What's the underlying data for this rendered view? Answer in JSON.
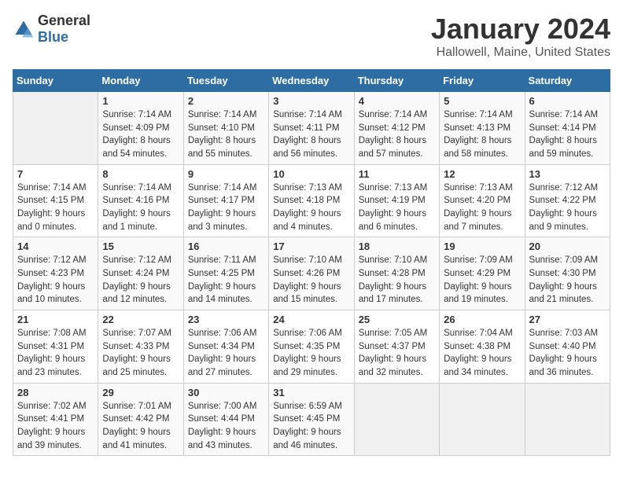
{
  "logo": {
    "general": "General",
    "blue": "Blue"
  },
  "header": {
    "month": "January 2024",
    "location": "Hallowell, Maine, United States"
  },
  "weekdays": [
    "Sunday",
    "Monday",
    "Tuesday",
    "Wednesday",
    "Thursday",
    "Friday",
    "Saturday"
  ],
  "weeks": [
    [
      {
        "day": "",
        "empty": true
      },
      {
        "day": "1",
        "sunrise": "Sunrise: 7:14 AM",
        "sunset": "Sunset: 4:09 PM",
        "daylight": "Daylight: 8 hours and 54 minutes."
      },
      {
        "day": "2",
        "sunrise": "Sunrise: 7:14 AM",
        "sunset": "Sunset: 4:10 PM",
        "daylight": "Daylight: 8 hours and 55 minutes."
      },
      {
        "day": "3",
        "sunrise": "Sunrise: 7:14 AM",
        "sunset": "Sunset: 4:11 PM",
        "daylight": "Daylight: 8 hours and 56 minutes."
      },
      {
        "day": "4",
        "sunrise": "Sunrise: 7:14 AM",
        "sunset": "Sunset: 4:12 PM",
        "daylight": "Daylight: 8 hours and 57 minutes."
      },
      {
        "day": "5",
        "sunrise": "Sunrise: 7:14 AM",
        "sunset": "Sunset: 4:13 PM",
        "daylight": "Daylight: 8 hours and 58 minutes."
      },
      {
        "day": "6",
        "sunrise": "Sunrise: 7:14 AM",
        "sunset": "Sunset: 4:14 PM",
        "daylight": "Daylight: 8 hours and 59 minutes."
      }
    ],
    [
      {
        "day": "7",
        "sunrise": "Sunrise: 7:14 AM",
        "sunset": "Sunset: 4:15 PM",
        "daylight": "Daylight: 9 hours and 0 minutes."
      },
      {
        "day": "8",
        "sunrise": "Sunrise: 7:14 AM",
        "sunset": "Sunset: 4:16 PM",
        "daylight": "Daylight: 9 hours and 1 minute."
      },
      {
        "day": "9",
        "sunrise": "Sunrise: 7:14 AM",
        "sunset": "Sunset: 4:17 PM",
        "daylight": "Daylight: 9 hours and 3 minutes."
      },
      {
        "day": "10",
        "sunrise": "Sunrise: 7:13 AM",
        "sunset": "Sunset: 4:18 PM",
        "daylight": "Daylight: 9 hours and 4 minutes."
      },
      {
        "day": "11",
        "sunrise": "Sunrise: 7:13 AM",
        "sunset": "Sunset: 4:19 PM",
        "daylight": "Daylight: 9 hours and 6 minutes."
      },
      {
        "day": "12",
        "sunrise": "Sunrise: 7:13 AM",
        "sunset": "Sunset: 4:20 PM",
        "daylight": "Daylight: 9 hours and 7 minutes."
      },
      {
        "day": "13",
        "sunrise": "Sunrise: 7:12 AM",
        "sunset": "Sunset: 4:22 PM",
        "daylight": "Daylight: 9 hours and 9 minutes."
      }
    ],
    [
      {
        "day": "14",
        "sunrise": "Sunrise: 7:12 AM",
        "sunset": "Sunset: 4:23 PM",
        "daylight": "Daylight: 9 hours and 10 minutes."
      },
      {
        "day": "15",
        "sunrise": "Sunrise: 7:12 AM",
        "sunset": "Sunset: 4:24 PM",
        "daylight": "Daylight: 9 hours and 12 minutes."
      },
      {
        "day": "16",
        "sunrise": "Sunrise: 7:11 AM",
        "sunset": "Sunset: 4:25 PM",
        "daylight": "Daylight: 9 hours and 14 minutes."
      },
      {
        "day": "17",
        "sunrise": "Sunrise: 7:10 AM",
        "sunset": "Sunset: 4:26 PM",
        "daylight": "Daylight: 9 hours and 15 minutes."
      },
      {
        "day": "18",
        "sunrise": "Sunrise: 7:10 AM",
        "sunset": "Sunset: 4:28 PM",
        "daylight": "Daylight: 9 hours and 17 minutes."
      },
      {
        "day": "19",
        "sunrise": "Sunrise: 7:09 AM",
        "sunset": "Sunset: 4:29 PM",
        "daylight": "Daylight: 9 hours and 19 minutes."
      },
      {
        "day": "20",
        "sunrise": "Sunrise: 7:09 AM",
        "sunset": "Sunset: 4:30 PM",
        "daylight": "Daylight: 9 hours and 21 minutes."
      }
    ],
    [
      {
        "day": "21",
        "sunrise": "Sunrise: 7:08 AM",
        "sunset": "Sunset: 4:31 PM",
        "daylight": "Daylight: 9 hours and 23 minutes."
      },
      {
        "day": "22",
        "sunrise": "Sunrise: 7:07 AM",
        "sunset": "Sunset: 4:33 PM",
        "daylight": "Daylight: 9 hours and 25 minutes."
      },
      {
        "day": "23",
        "sunrise": "Sunrise: 7:06 AM",
        "sunset": "Sunset: 4:34 PM",
        "daylight": "Daylight: 9 hours and 27 minutes."
      },
      {
        "day": "24",
        "sunrise": "Sunrise: 7:06 AM",
        "sunset": "Sunset: 4:35 PM",
        "daylight": "Daylight: 9 hours and 29 minutes."
      },
      {
        "day": "25",
        "sunrise": "Sunrise: 7:05 AM",
        "sunset": "Sunset: 4:37 PM",
        "daylight": "Daylight: 9 hours and 32 minutes."
      },
      {
        "day": "26",
        "sunrise": "Sunrise: 7:04 AM",
        "sunset": "Sunset: 4:38 PM",
        "daylight": "Daylight: 9 hours and 34 minutes."
      },
      {
        "day": "27",
        "sunrise": "Sunrise: 7:03 AM",
        "sunset": "Sunset: 4:40 PM",
        "daylight": "Daylight: 9 hours and 36 minutes."
      }
    ],
    [
      {
        "day": "28",
        "sunrise": "Sunrise: 7:02 AM",
        "sunset": "Sunset: 4:41 PM",
        "daylight": "Daylight: 9 hours and 39 minutes."
      },
      {
        "day": "29",
        "sunrise": "Sunrise: 7:01 AM",
        "sunset": "Sunset: 4:42 PM",
        "daylight": "Daylight: 9 hours and 41 minutes."
      },
      {
        "day": "30",
        "sunrise": "Sunrise: 7:00 AM",
        "sunset": "Sunset: 4:44 PM",
        "daylight": "Daylight: 9 hours and 43 minutes."
      },
      {
        "day": "31",
        "sunrise": "Sunrise: 6:59 AM",
        "sunset": "Sunset: 4:45 PM",
        "daylight": "Daylight: 9 hours and 46 minutes."
      },
      {
        "day": "",
        "empty": true
      },
      {
        "day": "",
        "empty": true
      },
      {
        "day": "",
        "empty": true
      }
    ]
  ]
}
